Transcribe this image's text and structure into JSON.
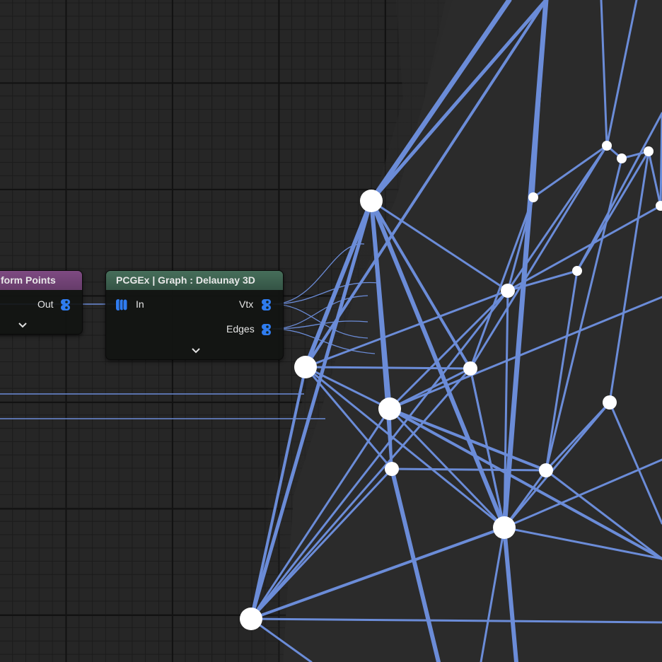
{
  "colors": {
    "wire": "#6b8cd8",
    "pin": "#2f7cf0",
    "vertex": "#ffffff",
    "transform_header": "#76457a",
    "delaunay_header": "#3d6350",
    "grid_bg": "#262626",
    "viewport_bg": "#2b2b2b"
  },
  "nodes": {
    "transform": {
      "title": "form Points",
      "out_label": "Out",
      "out_pin_icon": "point-data-pin-icon",
      "expand_icon": "chevron-down-icon"
    },
    "delaunay": {
      "title": "PCGEx | Graph : Delaunay 3D",
      "in_label": "In",
      "vtx_label": "Vtx",
      "edges_label": "Edges",
      "in_pin_icon": "point-data-pin-icon",
      "vtx_pin_icon": "point-data-pin-icon",
      "edges_pin_icon": "point-data-pin-icon",
      "expand_icon": "chevron-down-icon"
    }
  }
}
